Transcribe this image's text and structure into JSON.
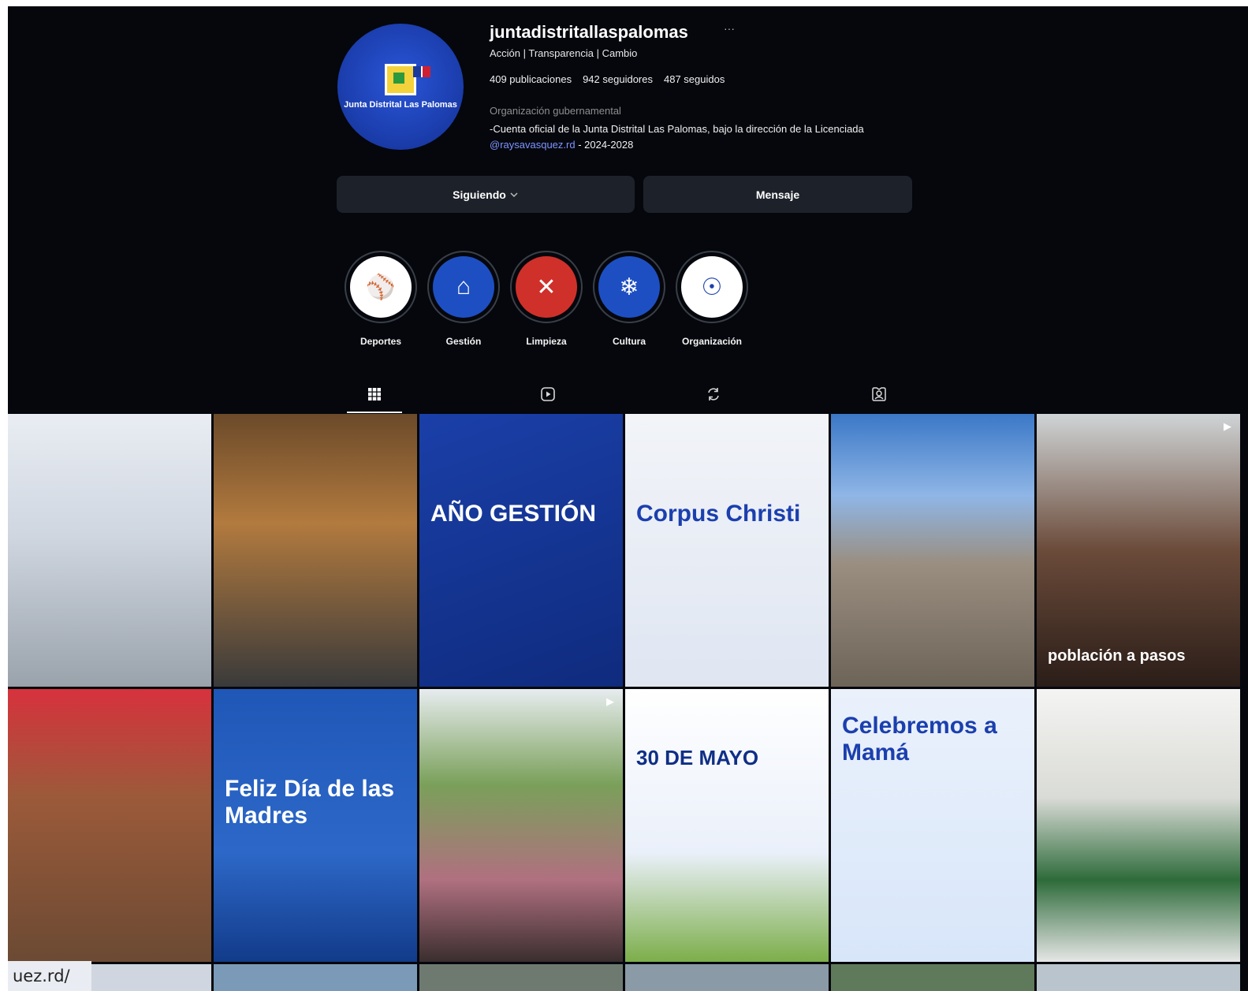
{
  "profile": {
    "username": "juntadistritallaspalomas",
    "more": "···",
    "avatar_text": "Junta Distrital Las Palomas",
    "tagline": "Acción | Transparencia | Cambio",
    "stats": {
      "posts": "409 publicaciones",
      "followers": "942 seguidores",
      "following": "487 seguidos"
    },
    "category": "Organización gubernamental",
    "bio_line1": "-Cuenta oficial de la Junta Distrital Las Palomas, bajo la dirección de la Licenciada",
    "bio_link": "@raysavasquez.rd",
    "bio_line2_rest": " - 2024-2028"
  },
  "actions": {
    "follow_label": "Siguiendo",
    "follow_icon": "chevron-down-icon",
    "message_label": "Mensaje"
  },
  "highlights": [
    {
      "label": "Deportes",
      "icon": "baseball-icon",
      "bg": "#ffffff",
      "fg": "#1b3fae"
    },
    {
      "label": "Gestión",
      "icon": "building-icon",
      "bg": "#1e4fc2",
      "fg": "#ffffff"
    },
    {
      "label": "Limpieza",
      "icon": "broom-icon",
      "bg": "#d0302a",
      "fg": "#ffffff"
    },
    {
      "label": "Cultura",
      "icon": "snowflake-icon",
      "bg": "#1e4fc2",
      "fg": "#ffffff"
    },
    {
      "label": "Organización",
      "icon": "people-network-icon",
      "bg": "#ffffff",
      "fg": "#1b3fae"
    }
  ],
  "tabs": [
    {
      "name": "posts",
      "icon": "grid-icon"
    },
    {
      "name": "reels",
      "icon": "reels-icon"
    },
    {
      "name": "reposts",
      "icon": "repost-icon"
    },
    {
      "name": "tagged",
      "icon": "tagged-icon"
    }
  ],
  "posts": [
    {
      "kind": "photo",
      "caption": "",
      "bg": "linear-gradient(180deg,#e9edf3 0%,#cfd6e0 45%,#9aa2ab 100%)"
    },
    {
      "kind": "photo",
      "caption": "",
      "bg": "linear-gradient(180deg,#6b4a2a 0%,#b27a3e 40%,#3a3a3a 100%)"
    },
    {
      "kind": "graphic",
      "caption": "AÑO GESTIÓN",
      "bg": "linear-gradient(160deg,#1a3fa8 0%,#0f2b7e 100%)"
    },
    {
      "kind": "graphic",
      "caption": "Corpus Christi",
      "bg": "linear-gradient(180deg,#f2f4f8 0%,#dfe6f2 100%)"
    },
    {
      "kind": "photo",
      "caption": "",
      "bg": "linear-gradient(180deg,#3b78c7 0%,#8fb6e6 30%,#9a8e80 55%,#6d6458 100%)"
    },
    {
      "kind": "video",
      "caption": "población a pasos",
      "bg": "linear-gradient(180deg,#cfd4d6 0%,#6b4b3a 50%,#2a1d18 100%)"
    },
    {
      "kind": "photo",
      "caption": "",
      "bg": "linear-gradient(180deg,#d7323d 0%,#9b5a3a 40%,#6b4a33 100%)"
    },
    {
      "kind": "graphic",
      "caption": "Feliz Día de las Madres",
      "bg": "linear-gradient(180deg,#1f57b7 0%,#2d68c8 60%,#123b8a 100%)"
    },
    {
      "kind": "video",
      "caption": "",
      "bg": "linear-gradient(180deg,#e7ecef 0%,#7aa05a 35%,#b07080 70%,#3a2e2e 100%)"
    },
    {
      "kind": "graphic",
      "caption": "30 DE MAYO",
      "bg": "linear-gradient(180deg,#ffffff 0%,#eaf0fa 60%,#7cae4a 100%)"
    },
    {
      "kind": "graphic",
      "caption": "Celebremos a Mamá",
      "bg": "linear-gradient(180deg,#eaf1fb 0%,#d8e6fa 100%)"
    },
    {
      "kind": "photo",
      "caption": "",
      "bg": "linear-gradient(180deg,#f4f4f2 0%,#d9dbd6 40%,#2e6b3a 70%,#e6e6e6 100%)"
    }
  ],
  "url_chip": "uez.rd/",
  "colors": {
    "background": "#05070d",
    "button_bg": "#1d222a",
    "link": "#7d95ff"
  }
}
